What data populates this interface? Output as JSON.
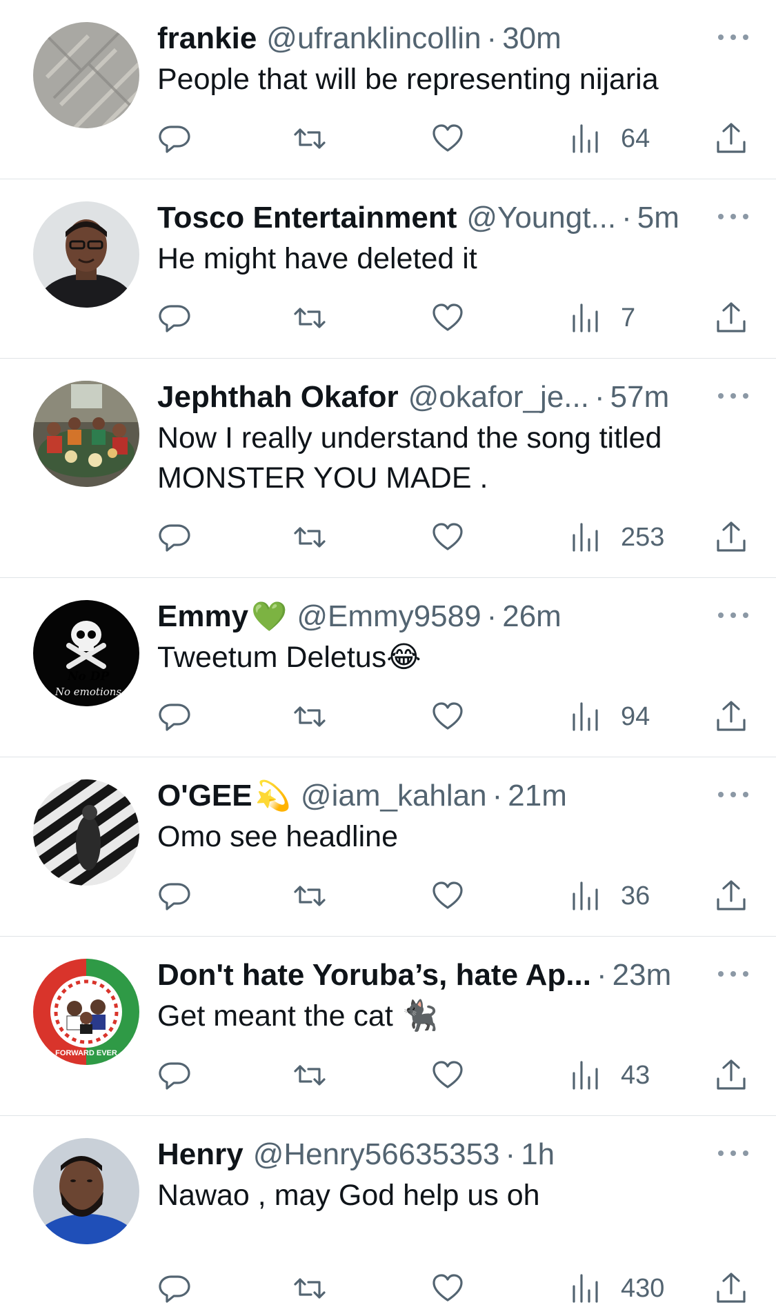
{
  "tweets": [
    {
      "name": "frankie",
      "name_emoji": "",
      "handle": "@ufranklincollin",
      "separator": "·",
      "time": "30m",
      "text": "People that will be representing nijaria",
      "views": "64",
      "avatar": "grey-pattern-avatar"
    },
    {
      "name": "Tosco Entertainment",
      "name_emoji": "",
      "handle": "@Youngt...",
      "separator": "·",
      "time": "5m",
      "text": "He might have deleted it",
      "views": "7",
      "avatar": "man-portrait-avatar"
    },
    {
      "name": "Jephthah Okafor",
      "name_emoji": "",
      "handle": "@okafor_je...",
      "separator": "·",
      "time": "57m",
      "text": "Now I really understand the song titled\nMONSTER YOU MADE .",
      "views": "253",
      "avatar": "family-dinner-avatar"
    },
    {
      "name": "Emmy",
      "name_emoji": "💚",
      "handle": "@Emmy9589",
      "separator": "·",
      "time": "26m",
      "text": "Tweetum Deletus😂",
      "views": "94",
      "avatar": "skull-no-dp-avatar",
      "avatar_text": [
        "No DP",
        "No emotions"
      ]
    },
    {
      "name": "O'GEE",
      "name_emoji": "💫",
      "handle": "@iam_kahlan",
      "separator": "·",
      "time": "21m",
      "text": "Omo see headline",
      "views": "36",
      "avatar": "striped-bw-avatar"
    },
    {
      "name": "Don't hate Yoruba’s, hate Ap...",
      "name_emoji": "",
      "handle": "",
      "separator": "·",
      "time": "23m",
      "text": "Get meant the cat 🐈‍⬛",
      "views": "43",
      "avatar": "forward-ever-logo-avatar",
      "avatar_text": [
        "FORWARD EVER"
      ]
    },
    {
      "name": "Henry",
      "name_emoji": "",
      "handle": "@Henry56635353",
      "separator": "·",
      "time": "1h",
      "text": "Nawao , may God help us oh",
      "views": "430",
      "avatar": "bearded-man-avatar"
    }
  ],
  "colors": {
    "text": "#0f1419",
    "secondary": "#536471",
    "divider": "#dfe3e6"
  }
}
